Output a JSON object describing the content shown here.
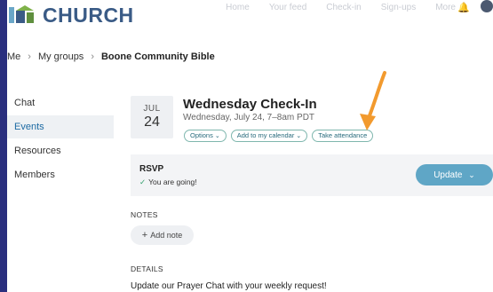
{
  "header": {
    "logo_text": "CHURCH",
    "nav": [
      "Home",
      "Your feed",
      "Check-in",
      "Sign-ups",
      "More"
    ]
  },
  "breadcrumb": {
    "items": [
      "Me",
      "My groups"
    ],
    "current": "Boone Community Bible"
  },
  "sidebar": {
    "items": [
      {
        "label": "Chat"
      },
      {
        "label": "Events"
      },
      {
        "label": "Resources"
      },
      {
        "label": "Members"
      }
    ],
    "active": "Events"
  },
  "event": {
    "month": "JUL",
    "day": "24",
    "title": "Wednesday Check-In",
    "time": "Wednesday, July 24, 7–8am PDT",
    "options_label": "Options",
    "calendar_label": "Add to my calendar",
    "attendance_label": "Take attendance"
  },
  "rsvp": {
    "title": "RSVP",
    "status": "You are going!",
    "update_label": "Update"
  },
  "notes": {
    "label": "NOTES",
    "add_label": "Add note"
  },
  "details": {
    "label": "DETAILS",
    "text": "Update our Prayer Chat with your weekly request!"
  },
  "colors": {
    "frame": "#2a2f7e",
    "accent": "#5fa6c6",
    "pill_border": "#7fb7ae",
    "annotation_arrow": "#f29a2e"
  }
}
